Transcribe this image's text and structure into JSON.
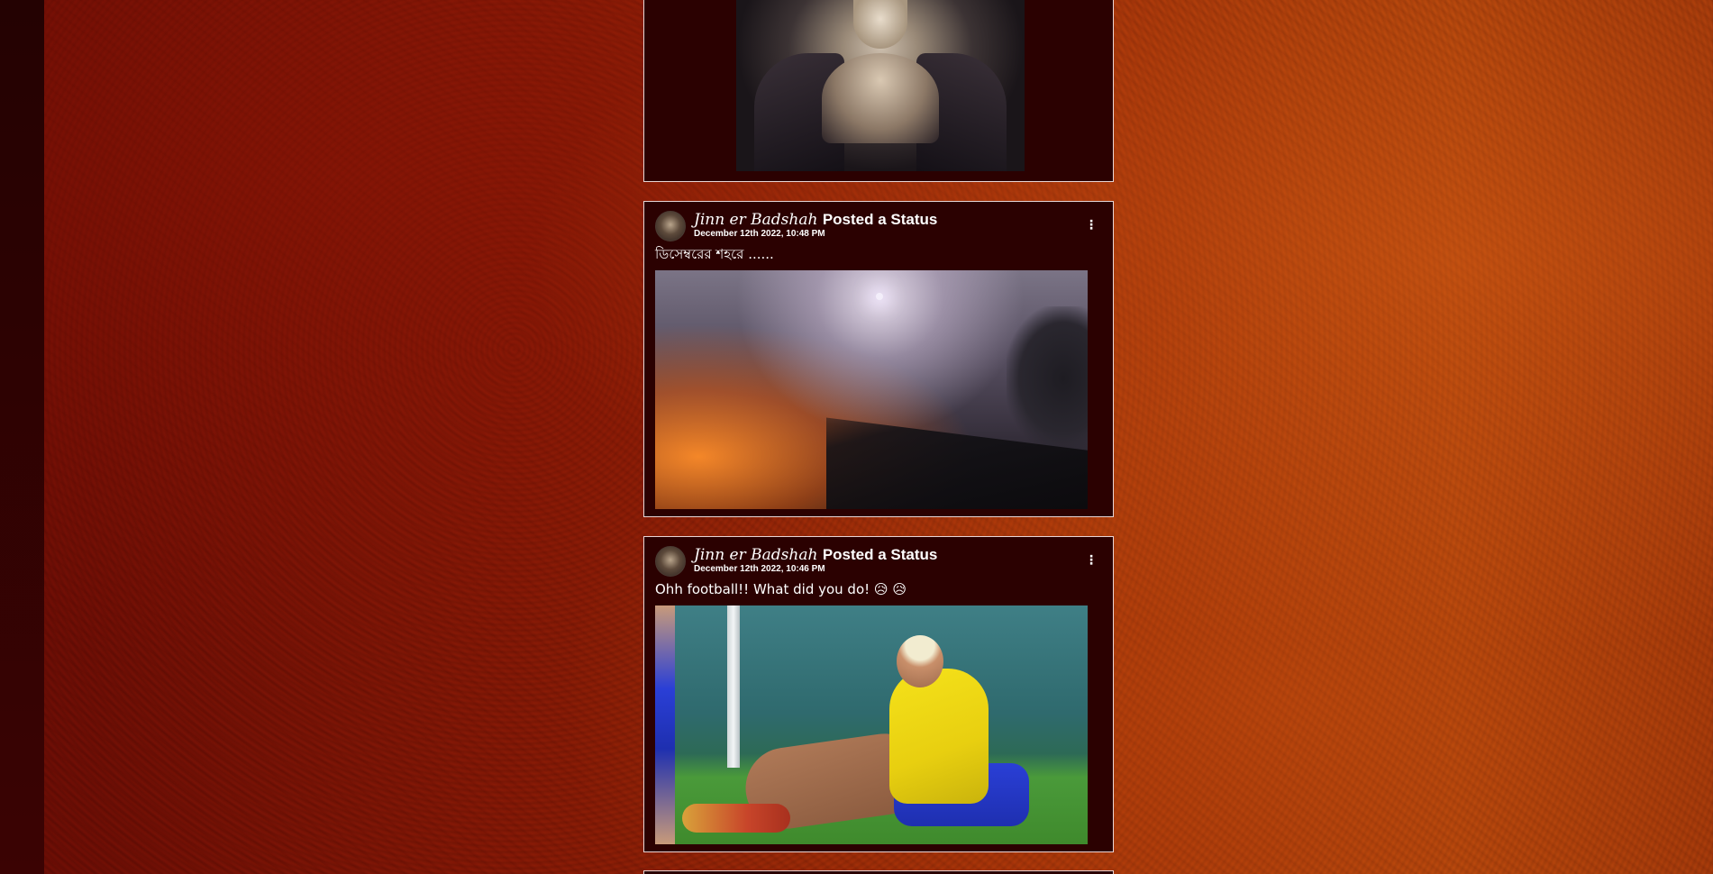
{
  "posts": [
    {
      "author": "Jinn er Badshah",
      "action": "Posted a Status",
      "date": "December 12th 2022, 10:48 PM",
      "text": "ডিসেম্বরের শহরে ......",
      "menu_icon": "more-vertical-icon"
    },
    {
      "author": "Jinn er Badshah",
      "action": "Posted a Status",
      "date": "December 12th 2022, 10:46 PM",
      "text": "Ohh football!! What did you do! 😥 😥",
      "menu_icon": "more-vertical-icon"
    }
  ],
  "colors": {
    "card_background": "#2b0101",
    "card_border": "#e8d6d6",
    "text": "#ffffff",
    "left_rail": "#2f0303"
  }
}
